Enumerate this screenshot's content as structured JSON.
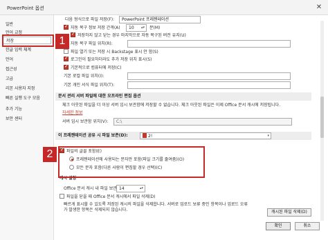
{
  "window": {
    "title": "PowerPoint 옵션",
    "close_glyph": "✕"
  },
  "sidebar": {
    "items": [
      {
        "label": "일반"
      },
      {
        "label": "언어 교정"
      },
      {
        "label": "저장"
      },
      {
        "label": "한글 입력 체계"
      },
      {
        "label": "언어"
      },
      {
        "label": "접근성"
      },
      {
        "label": "고급"
      },
      {
        "label": "리본 사용자 지정"
      },
      {
        "label": "빠른 실행 도구 모음"
      },
      {
        "label": "추가 기능"
      },
      {
        "label": "보안 센터"
      }
    ]
  },
  "save": {
    "format_label": "다음 형식으로 파일 저장(F):",
    "format_value": "PowerPoint 프레젠테이션",
    "autosave_label": "자동 복구 정보 저장 간격(A)",
    "autosave_minutes": "10",
    "autosave_unit": "분(M)",
    "keep_last_label": "저장하지 않고 닫는 경우 마지막으로 자동 복구된 버전 유지(U)",
    "recovery_path_label": "자동 복구 파일 위치(R):",
    "recovery_path_value": "",
    "no_backstage_label": "파일 열기 또는 저장 시 Backstage 표시 안 함(S)",
    "extra_locations_label": "로그인이 필요하더라도 추가 저장 위치 표시(S)",
    "default_pc_label": "기본적으로 컴퓨터에 저장(C)",
    "default_local_label": "기본 로컬 파일 위치(I):",
    "default_personal_label": "기본 개인 서식 파일 위치(T):"
  },
  "offline": {
    "header": "문서 관리 서버 파일에 대한 오프라인 편집 옵션",
    "desc": "체크 아웃된 파일을 더 이상 서버 임시 보관함에 저장할 수 없습니다. 체크 아웃된 파일은 이제 Office 문서 캐시에 저장됩니다.",
    "more_link": "자세한 정보",
    "server_drafts_label": "서버 임시 보관함 위치(V):",
    "server_drafts_value": "C:\\"
  },
  "fidelity": {
    "header": "이 프레젠테이션 공유 시 파일 보존(D):",
    "doc_name": "2!",
    "embed_fonts_label": "파일의 글꼴 포함(E)",
    "option1_label": "프레젠테이션에 사용되는 문자만 포함(파일 크기를 줄여줌)(O)",
    "option2_label": "모든 문자 포함(다른 사람이 편집할 경우 선택)(C)"
  },
  "cache": {
    "header": "캐시 설정",
    "days_label": "Office 문서 캐시 내 파일 보관 일수:",
    "days_value": "14",
    "delete_on_close_label": "파일을 닫을 때 Office 문서 캐시에서 파일 삭제(D)",
    "desc": "빠르게 표시할 수 있도록 저장된 캐시의 파일을 삭제합니다. 서버로 업로드 보류 중인 항목이나 업로드 오류 가 발생한 항목은 삭제되지 않습니다.",
    "delete_button": "캐시된 파일 삭제(D)"
  },
  "footer": {
    "ok": "확인",
    "cancel": "취소"
  },
  "callouts": {
    "one": "1",
    "two": "2"
  },
  "state": {
    "autosave_checked": true,
    "keep_last_checked": true,
    "no_backstage_checked": false,
    "extra_locations_checked": true,
    "default_pc_checked": true,
    "embed_fonts_checked": true,
    "option1_selected": true,
    "delete_on_close_checked": false
  },
  "colors": {
    "accent": "#c62828",
    "check": "#c0392b"
  }
}
